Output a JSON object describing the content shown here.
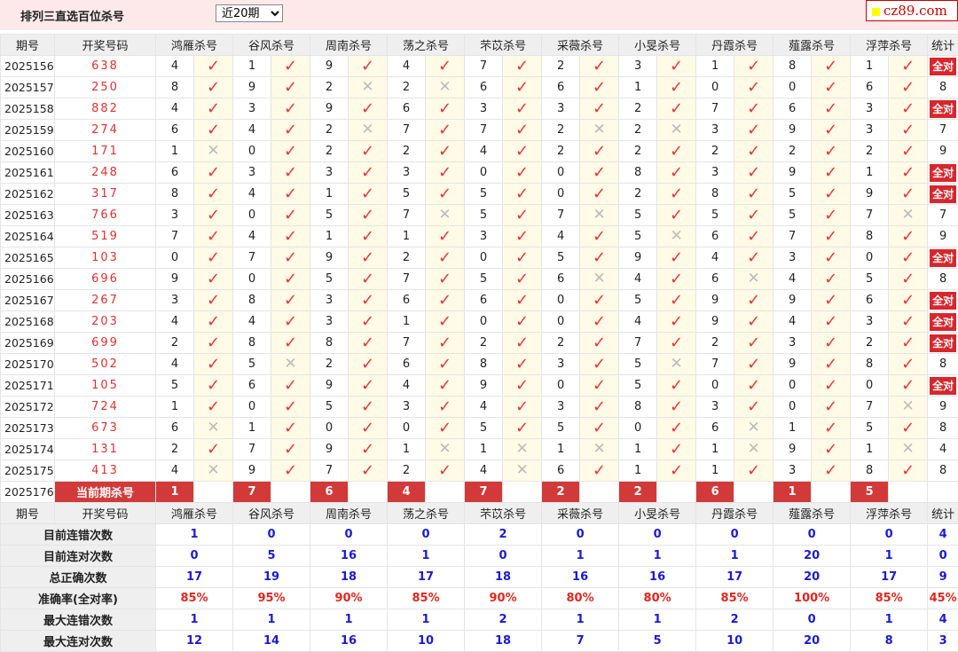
{
  "header": {
    "title": "排列三直选百位杀号",
    "period_select": "近20期",
    "logo_text": "cz89.com"
  },
  "columns": {
    "period": "期号",
    "draw": "开奖号码",
    "experts": [
      "鸿雁杀号",
      "谷风杀号",
      "周南杀号",
      "荡之杀号",
      "芣苡杀号",
      "采薇杀号",
      "小旻杀号",
      "丹霞杀号",
      "薤露杀号",
      "浮萍杀号"
    ],
    "stats": "统计"
  },
  "rows": [
    {
      "p": "2025156",
      "d": "638",
      "c": [
        [
          4,
          1
        ],
        [
          1,
          1
        ],
        [
          9,
          1
        ],
        [
          4,
          1
        ],
        [
          7,
          1
        ],
        [
          2,
          1
        ],
        [
          3,
          1
        ],
        [
          1,
          1
        ],
        [
          8,
          1
        ],
        [
          1,
          1
        ]
      ],
      "s": "全对"
    },
    {
      "p": "2025157",
      "d": "250",
      "c": [
        [
          8,
          1
        ],
        [
          9,
          1
        ],
        [
          2,
          0
        ],
        [
          2,
          0
        ],
        [
          6,
          1
        ],
        [
          6,
          1
        ],
        [
          1,
          1
        ],
        [
          0,
          1
        ],
        [
          0,
          1
        ],
        [
          6,
          1
        ]
      ],
      "s": "8"
    },
    {
      "p": "2025158",
      "d": "882",
      "c": [
        [
          4,
          1
        ],
        [
          3,
          1
        ],
        [
          9,
          1
        ],
        [
          6,
          1
        ],
        [
          3,
          1
        ],
        [
          3,
          1
        ],
        [
          2,
          1
        ],
        [
          7,
          1
        ],
        [
          6,
          1
        ],
        [
          3,
          1
        ]
      ],
      "s": "全对"
    },
    {
      "p": "2025159",
      "d": "274",
      "c": [
        [
          6,
          1
        ],
        [
          4,
          1
        ],
        [
          2,
          0
        ],
        [
          7,
          1
        ],
        [
          7,
          1
        ],
        [
          2,
          0
        ],
        [
          2,
          0
        ],
        [
          3,
          1
        ],
        [
          9,
          1
        ],
        [
          3,
          1
        ]
      ],
      "s": "7"
    },
    {
      "p": "2025160",
      "d": "171",
      "c": [
        [
          1,
          0
        ],
        [
          0,
          1
        ],
        [
          2,
          1
        ],
        [
          2,
          1
        ],
        [
          4,
          1
        ],
        [
          2,
          1
        ],
        [
          2,
          1
        ],
        [
          2,
          1
        ],
        [
          2,
          1
        ],
        [
          2,
          1
        ]
      ],
      "s": "9"
    },
    {
      "p": "2025161",
      "d": "248",
      "c": [
        [
          6,
          1
        ],
        [
          3,
          1
        ],
        [
          3,
          1
        ],
        [
          3,
          1
        ],
        [
          0,
          1
        ],
        [
          0,
          1
        ],
        [
          8,
          1
        ],
        [
          3,
          1
        ],
        [
          9,
          1
        ],
        [
          1,
          1
        ]
      ],
      "s": "全对"
    },
    {
      "p": "2025162",
      "d": "317",
      "c": [
        [
          8,
          1
        ],
        [
          4,
          1
        ],
        [
          1,
          1
        ],
        [
          5,
          1
        ],
        [
          5,
          1
        ],
        [
          0,
          1
        ],
        [
          2,
          1
        ],
        [
          8,
          1
        ],
        [
          5,
          1
        ],
        [
          9,
          1
        ]
      ],
      "s": "全对"
    },
    {
      "p": "2025163",
      "d": "766",
      "c": [
        [
          3,
          1
        ],
        [
          0,
          1
        ],
        [
          5,
          1
        ],
        [
          7,
          0
        ],
        [
          5,
          1
        ],
        [
          7,
          0
        ],
        [
          5,
          1
        ],
        [
          5,
          1
        ],
        [
          5,
          1
        ],
        [
          7,
          0
        ]
      ],
      "s": "7"
    },
    {
      "p": "2025164",
      "d": "519",
      "c": [
        [
          7,
          1
        ],
        [
          4,
          1
        ],
        [
          1,
          1
        ],
        [
          1,
          1
        ],
        [
          3,
          1
        ],
        [
          4,
          1
        ],
        [
          5,
          0
        ],
        [
          6,
          1
        ],
        [
          7,
          1
        ],
        [
          8,
          1
        ]
      ],
      "s": "9"
    },
    {
      "p": "2025165",
      "d": "103",
      "c": [
        [
          0,
          1
        ],
        [
          7,
          1
        ],
        [
          9,
          1
        ],
        [
          2,
          1
        ],
        [
          0,
          1
        ],
        [
          5,
          1
        ],
        [
          9,
          1
        ],
        [
          4,
          1
        ],
        [
          3,
          1
        ],
        [
          0,
          1
        ]
      ],
      "s": "全对"
    },
    {
      "p": "2025166",
      "d": "696",
      "c": [
        [
          9,
          1
        ],
        [
          0,
          1
        ],
        [
          5,
          1
        ],
        [
          7,
          1
        ],
        [
          5,
          1
        ],
        [
          6,
          0
        ],
        [
          4,
          1
        ],
        [
          6,
          0
        ],
        [
          4,
          1
        ],
        [
          5,
          1
        ]
      ],
      "s": "8"
    },
    {
      "p": "2025167",
      "d": "267",
      "c": [
        [
          3,
          1
        ],
        [
          8,
          1
        ],
        [
          3,
          1
        ],
        [
          6,
          1
        ],
        [
          6,
          1
        ],
        [
          0,
          1
        ],
        [
          5,
          1
        ],
        [
          9,
          1
        ],
        [
          9,
          1
        ],
        [
          6,
          1
        ]
      ],
      "s": "全对"
    },
    {
      "p": "2025168",
      "d": "203",
      "c": [
        [
          4,
          1
        ],
        [
          4,
          1
        ],
        [
          3,
          1
        ],
        [
          1,
          1
        ],
        [
          0,
          1
        ],
        [
          0,
          1
        ],
        [
          4,
          1
        ],
        [
          9,
          1
        ],
        [
          4,
          1
        ],
        [
          3,
          1
        ]
      ],
      "s": "全对"
    },
    {
      "p": "2025169",
      "d": "699",
      "c": [
        [
          2,
          1
        ],
        [
          8,
          1
        ],
        [
          8,
          1
        ],
        [
          7,
          1
        ],
        [
          2,
          1
        ],
        [
          2,
          1
        ],
        [
          7,
          1
        ],
        [
          2,
          1
        ],
        [
          3,
          1
        ],
        [
          2,
          1
        ]
      ],
      "s": "全对"
    },
    {
      "p": "2025170",
      "d": "502",
      "c": [
        [
          4,
          1
        ],
        [
          5,
          0
        ],
        [
          2,
          1
        ],
        [
          6,
          1
        ],
        [
          8,
          1
        ],
        [
          3,
          1
        ],
        [
          5,
          0
        ],
        [
          7,
          1
        ],
        [
          9,
          1
        ],
        [
          8,
          1
        ]
      ],
      "s": "8"
    },
    {
      "p": "2025171",
      "d": "105",
      "c": [
        [
          5,
          1
        ],
        [
          6,
          1
        ],
        [
          9,
          1
        ],
        [
          4,
          1
        ],
        [
          9,
          1
        ],
        [
          0,
          1
        ],
        [
          5,
          1
        ],
        [
          0,
          1
        ],
        [
          0,
          1
        ],
        [
          0,
          1
        ]
      ],
      "s": "全对"
    },
    {
      "p": "2025172",
      "d": "724",
      "c": [
        [
          1,
          1
        ],
        [
          0,
          1
        ],
        [
          5,
          1
        ],
        [
          3,
          1
        ],
        [
          4,
          1
        ],
        [
          3,
          1
        ],
        [
          8,
          1
        ],
        [
          3,
          1
        ],
        [
          0,
          1
        ],
        [
          7,
          0
        ]
      ],
      "s": "9"
    },
    {
      "p": "2025173",
      "d": "673",
      "c": [
        [
          6,
          0
        ],
        [
          1,
          1
        ],
        [
          0,
          1
        ],
        [
          0,
          1
        ],
        [
          5,
          1
        ],
        [
          5,
          1
        ],
        [
          0,
          1
        ],
        [
          6,
          0
        ],
        [
          1,
          1
        ],
        [
          5,
          1
        ]
      ],
      "s": "8"
    },
    {
      "p": "2025174",
      "d": "131",
      "c": [
        [
          2,
          1
        ],
        [
          7,
          1
        ],
        [
          9,
          1
        ],
        [
          1,
          0
        ],
        [
          1,
          0
        ],
        [
          1,
          0
        ],
        [
          1,
          1
        ],
        [
          1,
          0
        ],
        [
          9,
          1
        ],
        [
          1,
          0
        ]
      ],
      "s": "4"
    },
    {
      "p": "2025175",
      "d": "413",
      "c": [
        [
          4,
          0
        ],
        [
          9,
          1
        ],
        [
          7,
          1
        ],
        [
          2,
          1
        ],
        [
          4,
          0
        ],
        [
          6,
          1
        ],
        [
          1,
          1
        ],
        [
          1,
          1
        ],
        [
          3,
          1
        ],
        [
          8,
          1
        ]
      ],
      "s": "8"
    }
  ],
  "current": {
    "period": "2025176",
    "label": "当前期杀号",
    "values": [
      "1",
      "7",
      "6",
      "4",
      "7",
      "2",
      "2",
      "6",
      "1",
      "5"
    ]
  },
  "marks": {
    "ok": "✓",
    "no": "✕"
  },
  "stats": [
    {
      "label": "目前连错次数",
      "values": [
        "1",
        "0",
        "0",
        "0",
        "2",
        "0",
        "0",
        "0",
        "0",
        "0"
      ],
      "total": "4",
      "color": "blue"
    },
    {
      "label": "目前连对次数",
      "values": [
        "0",
        "5",
        "16",
        "1",
        "0",
        "1",
        "1",
        "1",
        "20",
        "1"
      ],
      "total": "0",
      "color": "blue"
    },
    {
      "label": "总正确次数",
      "values": [
        "17",
        "19",
        "18",
        "17",
        "18",
        "16",
        "16",
        "17",
        "20",
        "17"
      ],
      "total": "9",
      "color": "blue"
    },
    {
      "label": "准确率(全对率)",
      "values": [
        "85%",
        "95%",
        "90%",
        "85%",
        "90%",
        "80%",
        "80%",
        "85%",
        "100%",
        "85%"
      ],
      "total": "45%",
      "color": "red"
    },
    {
      "label": "最大连错次数",
      "values": [
        "1",
        "1",
        "1",
        "1",
        "2",
        "1",
        "1",
        "2",
        "0",
        "1"
      ],
      "total": "4",
      "color": "blue"
    },
    {
      "label": "最大连对次数",
      "values": [
        "12",
        "14",
        "16",
        "10",
        "18",
        "7",
        "5",
        "10",
        "20",
        "8"
      ],
      "total": "3",
      "color": "blue"
    }
  ],
  "colors": {
    "ok": "#e8343a",
    "no": "#bbbbbb",
    "badge": "#d9262c",
    "current": "#d23a3a",
    "blue": "#1a1ad6",
    "red": "#e0261e"
  }
}
